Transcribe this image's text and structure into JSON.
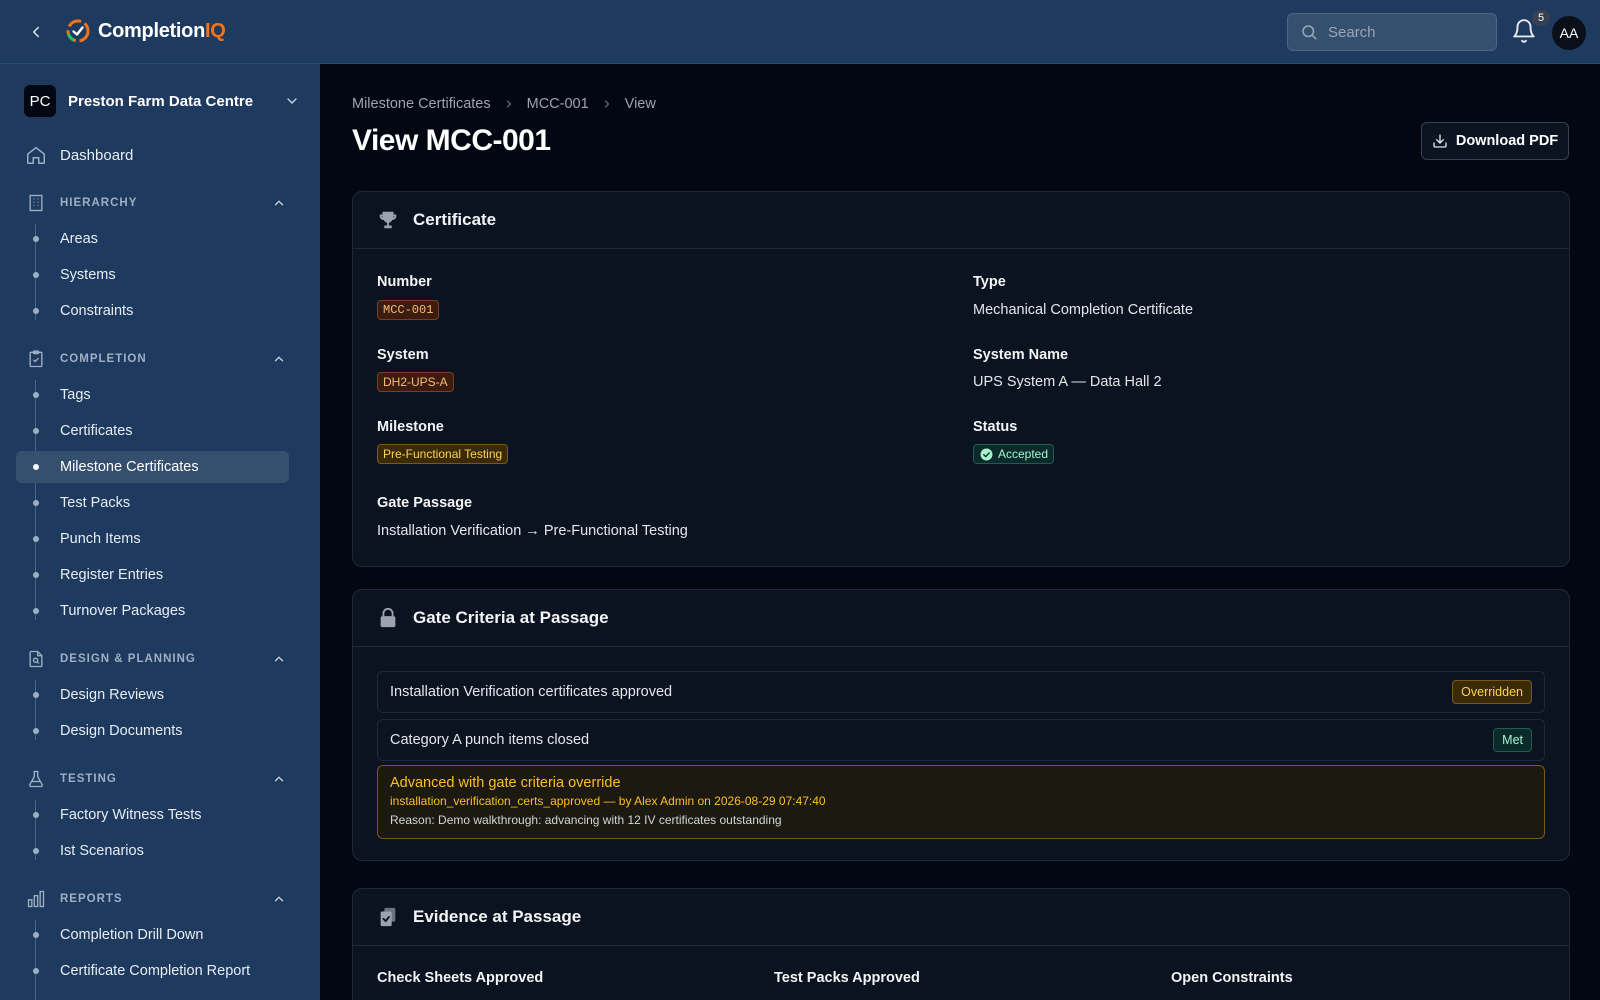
{
  "header": {
    "brand_name": "Completion",
    "brand_suffix": "IQ",
    "search_placeholder": "Search",
    "notification_count": "5",
    "avatar_initials": "AA",
    "accent_color": "#f97316"
  },
  "sidebar": {
    "project_initials": "PC",
    "project_name": "Preston Farm Data Centre",
    "dashboard_label": "Dashboard",
    "sections": [
      {
        "label": "HIERARCHY",
        "icon": "building-icon",
        "items": [
          "Areas",
          "Systems",
          "Constraints"
        ]
      },
      {
        "label": "COMPLETION",
        "icon": "clipboard-check-icon",
        "items": [
          "Tags",
          "Certificates",
          "Milestone Certificates",
          "Test Packs",
          "Punch Items",
          "Register Entries",
          "Turnover Packages"
        ]
      },
      {
        "label": "DESIGN & PLANNING",
        "icon": "file-search-icon",
        "items": [
          "Design Reviews",
          "Design Documents"
        ]
      },
      {
        "label": "TESTING",
        "icon": "flask-icon",
        "items": [
          "Factory Witness Tests",
          "Ist Scenarios"
        ]
      },
      {
        "label": "REPORTS",
        "icon": "bar-chart-icon",
        "items": [
          "Completion Drill Down",
          "Certificate Completion Report"
        ]
      }
    ],
    "active_item": "Milestone Certificates"
  },
  "main": {
    "breadcrumb": [
      "Milestone Certificates",
      "MCC-001",
      "View"
    ],
    "page_title": "View MCC-001",
    "download_label": "Download PDF",
    "certificate": {
      "title": "Certificate",
      "number_label": "Number",
      "number_value": "MCC-001",
      "type_label": "Type",
      "type_value": "Mechanical Completion Certificate",
      "system_label": "System",
      "system_value": "DH2-UPS-A",
      "system_name_label": "System Name",
      "system_name_value": "UPS System A — Data Hall 2",
      "milestone_label": "Milestone",
      "milestone_value": "Pre-Functional Testing",
      "status_label": "Status",
      "status_value": "Accepted",
      "gate_label": "Gate Passage",
      "gate_value": "Installation Verification → Pre-Functional Testing"
    },
    "gate_criteria": {
      "title": "Gate Criteria at Passage",
      "rows": [
        {
          "text": "Installation Verification certificates approved",
          "badge": "Overridden"
        },
        {
          "text": "Category A punch items closed",
          "badge": "Met"
        }
      ],
      "override_title": "Advanced with gate criteria override",
      "override_detail": "installation_verification_certs_approved — by Alex Admin on 2026-08-29 07:47:40",
      "override_reason": "Reason: Demo walkthrough: advancing with 12 IV certificates outstanding"
    },
    "evidence": {
      "title": "Evidence at Passage",
      "columns": [
        "Check Sheets Approved",
        "Test Packs Approved",
        "Open Constraints"
      ]
    }
  }
}
